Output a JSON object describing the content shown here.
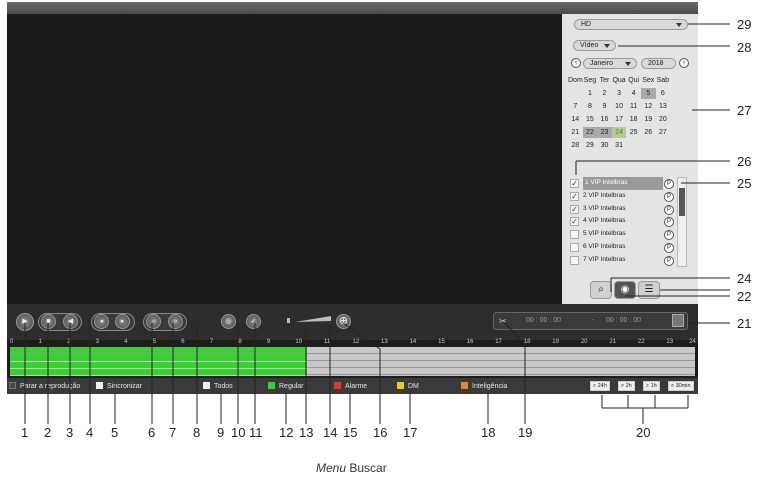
{
  "panel": {
    "quality": "HD",
    "type": "Vídeo",
    "month": "Janeiro",
    "year": "2018"
  },
  "calendar": {
    "weekdays": [
      "Dom",
      "Seg",
      "Ter",
      "Qua",
      "Qui",
      "Sex",
      "Sab"
    ],
    "weeks": [
      [
        "",
        "",
        "",
        "",
        "",
        "",
        ""
      ],
      [
        "",
        "1",
        "2",
        "3",
        "4",
        "5",
        "6"
      ],
      [
        "7",
        "8",
        "9",
        "10",
        "11",
        "12",
        "13"
      ],
      [
        "14",
        "15",
        "16",
        "17",
        "18",
        "19",
        "20"
      ],
      [
        "21",
        "22",
        "23",
        "24",
        "25",
        "26",
        "27"
      ],
      [
        "28",
        "29",
        "30",
        "31",
        "",
        "",
        ""
      ]
    ]
  },
  "channels": [
    {
      "label": "1 VIP Intelbras",
      "checked": true
    },
    {
      "label": "2 VIP Intelbras",
      "checked": true
    },
    {
      "label": "3 VIP Intelbras",
      "checked": true
    },
    {
      "label": "4 VIP Intelbras",
      "checked": true
    },
    {
      "label": "5 VIP Intelbras",
      "checked": false
    },
    {
      "label": "6 VIP Intelbras",
      "checked": false
    },
    {
      "label": "7 VIP Intelbras",
      "checked": false
    }
  ],
  "playback_icon": "P",
  "time_fields": {
    "start": "00 : 00 : 00",
    "dash": "-",
    "end": "00 : 00 : 00"
  },
  "timeline_hours": [
    "0",
    "1",
    "2",
    "3",
    "4",
    "5",
    "6",
    "7",
    "8",
    "9",
    "10",
    "11",
    "12",
    "13",
    "14",
    "15",
    "16",
    "17",
    "18",
    "19",
    "20",
    "21",
    "22",
    "23",
    "24"
  ],
  "legend": {
    "stop": "Parar a reprodução",
    "sync": "Sincronizar",
    "all": "Todos",
    "regular": "Regular",
    "alarm": "Alarme",
    "md": "DM",
    "intel": "Inteligência"
  },
  "zoom": [
    "24h",
    "2h",
    "1h",
    "30min"
  ],
  "colors": {
    "regular": "#39d12f",
    "alarm": "#e23a2a",
    "md": "#e6d01e",
    "intel": "#e08a2a"
  },
  "callouts": [
    "1",
    "2",
    "3",
    "4",
    "5",
    "6",
    "7",
    "8",
    "9",
    "10",
    "11",
    "12",
    "13",
    "14",
    "15",
    "16",
    "17",
    "18",
    "19",
    "20",
    "21",
    "22",
    "23",
    "24",
    "25",
    "26",
    "27",
    "28",
    "29"
  ],
  "caption": {
    "menu": "Menu",
    "rest": "Buscar"
  }
}
